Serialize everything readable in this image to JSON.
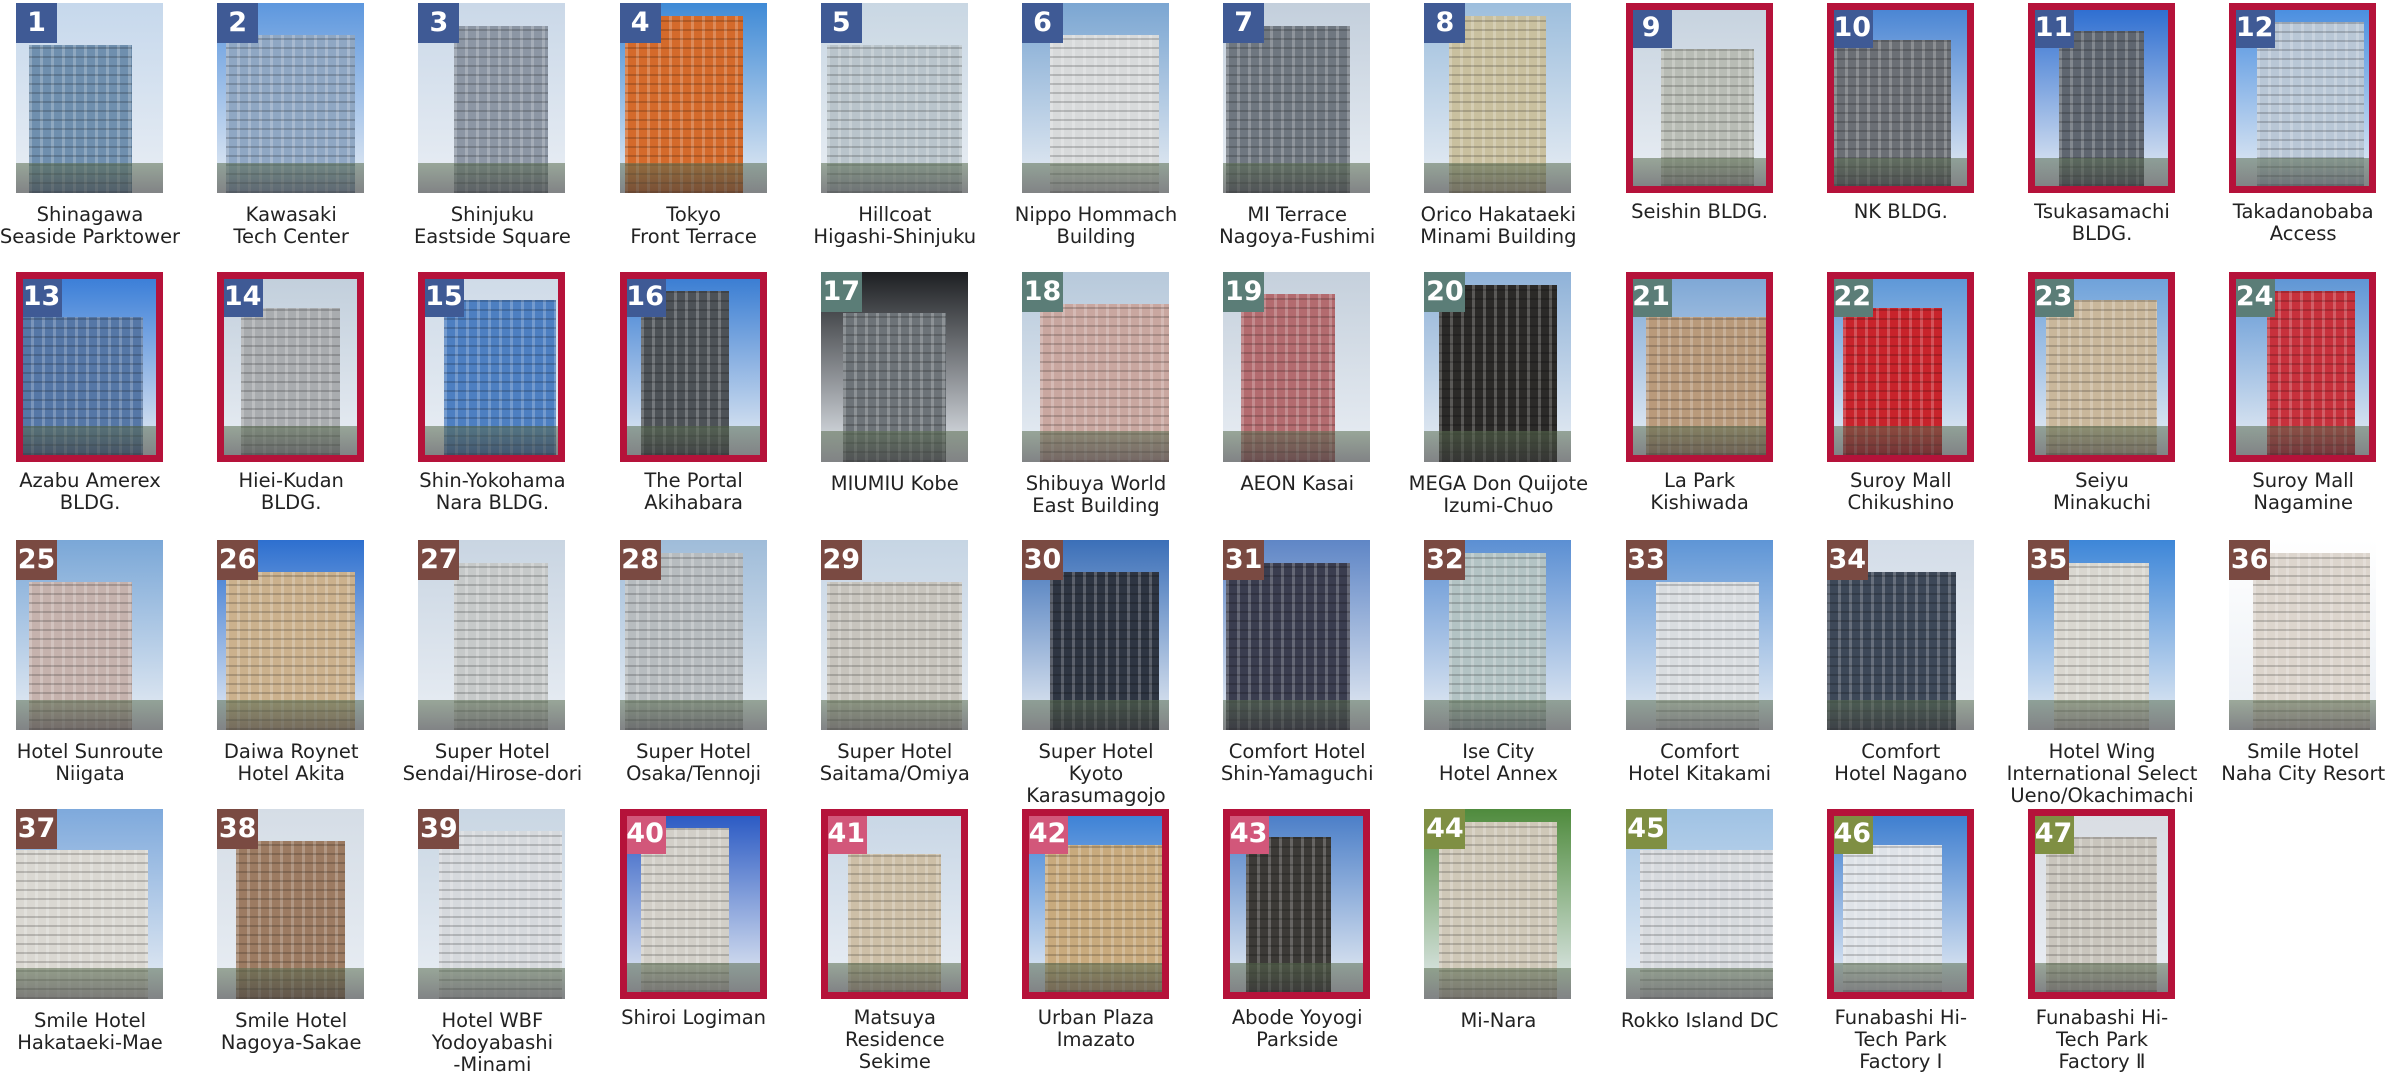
{
  "colors": {
    "highlight_border": "#b5123a",
    "category_badge": [
      "#3f5a95",
      "#5b7d77",
      "#7a4a42",
      "#d2577a",
      "#7f8f43"
    ]
  },
  "properties": [
    {
      "num": "1",
      "name": "Shinagawa\nSeaside Parktower",
      "badge_color": "#3f5a95",
      "highlighted": false,
      "sky": "#c6d8ec",
      "bldg": "#6f8fae"
    },
    {
      "num": "2",
      "name": "Kawasaki\nTech Center",
      "badge_color": "#3f5a95",
      "highlighted": false,
      "sky": "#5d97de",
      "bldg": "#8fa7c3"
    },
    {
      "num": "3",
      "name": "Shinjuku\nEastside Square",
      "badge_color": "#3f5a95",
      "highlighted": false,
      "sky": "#cad8e8",
      "bldg": "#8c96a4"
    },
    {
      "num": "4",
      "name": "Tokyo\nFront Terrace",
      "badge_color": "#3f5a95",
      "highlighted": false,
      "sky": "#3f8ad6",
      "bldg": "#d46a2b"
    },
    {
      "num": "5",
      "name": "Hillcoat\nHigashi-Shinjuku",
      "badge_color": "#3f5a95",
      "highlighted": false,
      "sky": "#c9d7e3",
      "bldg": "#b9c4cb"
    },
    {
      "num": "6",
      "name": "Nippo Hommach\nBuilding",
      "badge_color": "#3f5a95",
      "highlighted": false,
      "sky": "#7ba6d2",
      "bldg": "#d8dadb"
    },
    {
      "num": "7",
      "name": "MI Terrace\nNagoya-Fushimi",
      "badge_color": "#3f5a95",
      "highlighted": false,
      "sky": "#c3cfdc",
      "bldg": "#6f7780"
    },
    {
      "num": "8",
      "name": "Orico Hakataeki\nMinami Building",
      "badge_color": "#3f5a95",
      "highlighted": false,
      "sky": "#9dbedd",
      "bldg": "#c9c09f"
    },
    {
      "num": "9",
      "name": "Seishin BLDG.",
      "badge_color": "#3f5a95",
      "highlighted": true,
      "sky": "#c7d3df",
      "bldg": "#b8bcb5"
    },
    {
      "num": "10",
      "name": "NK BLDG.",
      "badge_color": "#3f5a95",
      "highlighted": true,
      "sky": "#4b86d4",
      "bldg": "#6b6f75"
    },
    {
      "num": "11",
      "name": "Tsukasamachi\nBLDG.",
      "badge_color": "#3f5a95",
      "highlighted": true,
      "sky": "#2f6fd1",
      "bldg": "#5f6670"
    },
    {
      "num": "12",
      "name": "Takadanobaba\nAccess",
      "badge_color": "#3f5a95",
      "highlighted": true,
      "sky": "#4b8fe0",
      "bldg": "#b9c7d6"
    },
    {
      "num": "13",
      "name": "Azabu Amerex\nBLDG.",
      "badge_color": "#3f5a95",
      "highlighted": true,
      "sky": "#3c7fd8",
      "bldg": "#5577a6"
    },
    {
      "num": "14",
      "name": "Hiei-Kudan\nBLDG.",
      "badge_color": "#3f5a95",
      "highlighted": true,
      "sky": "#c2cfdc",
      "bldg": "#a9acaf"
    },
    {
      "num": "15",
      "name": "Shin-Yokohama\nNara BLDG.",
      "badge_color": "#3f5a95",
      "highlighted": true,
      "sky": "#cfdbe8",
      "bldg": "#4d7fc1"
    },
    {
      "num": "16",
      "name": "The Portal\nAkihabara",
      "badge_color": "#3f5a95",
      "highlighted": true,
      "sky": "#3b7ed3",
      "bldg": "#4d5257"
    },
    {
      "num": "17",
      "name": "MIUMIU Kobe",
      "badge_color": "#5b7d77",
      "highlighted": false,
      "sky": "#1d1f22",
      "bldg": "#6d7378"
    },
    {
      "num": "18",
      "name": "Shibuya World\nEast Building",
      "badge_color": "#5b7d77",
      "highlighted": false,
      "sky": "#b7c9db",
      "bldg": "#c9a7a0"
    },
    {
      "num": "19",
      "name": "AEON Kasai",
      "badge_color": "#5b7d77",
      "highlighted": false,
      "sky": "#c5d0dc",
      "bldg": "#b36b6f"
    },
    {
      "num": "20",
      "name": "MEGA Don Quijote\nIzumi-Chuo",
      "badge_color": "#5b7d77",
      "highlighted": false,
      "sky": "#8fb2d8",
      "bldg": "#2b2a28"
    },
    {
      "num": "21",
      "name": "La Park\nKishiwada",
      "badge_color": "#5b7d77",
      "highlighted": true,
      "sky": "#7fa8d6",
      "bldg": "#b99a7b"
    },
    {
      "num": "22",
      "name": "Suroy Mall\nChikushino",
      "badge_color": "#5b7d77",
      "highlighted": true,
      "sky": "#5e98d8",
      "bldg": "#c8232b"
    },
    {
      "num": "23",
      "name": "Seiyu\nMinakuchi",
      "badge_color": "#5b7d77",
      "highlighted": true,
      "sky": "#6fa2da",
      "bldg": "#c9b79b"
    },
    {
      "num": "24",
      "name": "Suroy Mall\nNagamine",
      "badge_color": "#5b7d77",
      "highlighted": true,
      "sky": "#5f96d5",
      "bldg": "#c7313c"
    },
    {
      "num": "25",
      "name": "Hotel Sunroute\nNiigata",
      "badge_color": "#7a4a42",
      "highlighted": false,
      "sky": "#7aa7d7",
      "bldg": "#c5b2ad"
    },
    {
      "num": "26",
      "name": "Daiwa Roynet\nHotel Akita",
      "badge_color": "#7a4a42",
      "highlighted": false,
      "sky": "#2d6fcf",
      "bldg": "#cbb18d"
    },
    {
      "num": "27",
      "name": "Super Hotel\nSendai/Hirose-dori",
      "badge_color": "#7a4a42",
      "highlighted": false,
      "sky": "#c9d5e2",
      "bldg": "#c6c9c9"
    },
    {
      "num": "28",
      "name": "Super Hotel\nOsaka/Tennoji",
      "badge_color": "#7a4a42",
      "highlighted": false,
      "sky": "#9fbcd9",
      "bldg": "#b7bcbf"
    },
    {
      "num": "29",
      "name": "Super Hotel\nSaitama/Omiya",
      "badge_color": "#7a4a42",
      "highlighted": false,
      "sky": "#c6d5e4",
      "bldg": "#c7c4bd"
    },
    {
      "num": "30",
      "name": "Super Hotel\nKyoto\nKarasumagojo",
      "badge_color": "#7a4a42",
      "highlighted": false,
      "sky": "#3b6fb8",
      "bldg": "#2e3542"
    },
    {
      "num": "31",
      "name": "Comfort Hotel\nShin-Yamaguchi",
      "badge_color": "#7a4a42",
      "highlighted": false,
      "sky": "#5f86c6",
      "bldg": "#3a3d4f"
    },
    {
      "num": "32",
      "name": "Ise City\nHotel Annex",
      "badge_color": "#7a4a42",
      "highlighted": false,
      "sky": "#5b8fd3",
      "bldg": "#b3c3c4"
    },
    {
      "num": "33",
      "name": "Comfort\nHotel Kitakami",
      "badge_color": "#7a4a42",
      "highlighted": false,
      "sky": "#5e95d6",
      "bldg": "#d9dde0"
    },
    {
      "num": "34",
      "name": "Comfort\nHotel Nagano",
      "badge_color": "#7a4a42",
      "highlighted": false,
      "sky": "#d4dde8",
      "bldg": "#3d4858"
    },
    {
      "num": "35",
      "name": "Hotel Wing\nInternational Select\nUeno/Okachimachi",
      "badge_color": "#7a4a42",
      "highlighted": false,
      "sky": "#3d86d8",
      "bldg": "#d9d7d0"
    },
    {
      "num": "36",
      "name": "Smile Hotel\nNaha City Resort",
      "badge_color": "#7a4a42",
      "highlighted": false,
      "sky": "#ffffff",
      "bldg": "#dcd5cd"
    },
    {
      "num": "37",
      "name": "Smile Hotel\nHakataeki-Mae",
      "badge_color": "#7a4a42",
      "highlighted": false,
      "sky": "#7ea9dc",
      "bldg": "#dad8d2"
    },
    {
      "num": "38",
      "name": "Smile Hotel\nNagoya-Sakae",
      "badge_color": "#7a4a42",
      "highlighted": false,
      "sky": "#d5dde6",
      "bldg": "#9c7b62"
    },
    {
      "num": "39",
      "name": "Hotel WBF\nYodoyabashi\n-Minami",
      "badge_color": "#7a4a42",
      "highlighted": false,
      "sky": "#c9d6e3",
      "bldg": "#d6d9dd"
    },
    {
      "num": "40",
      "name": "Shiroi Logiman",
      "badge_color": "#d2577a",
      "highlighted": true,
      "sky": "#2c5bc4",
      "bldg": "#d2cfc8"
    },
    {
      "num": "41",
      "name": "Matsuya\nResidence\nSekime",
      "badge_color": "#d2577a",
      "highlighted": true,
      "sky": "#c9d7e6",
      "bldg": "#cdbfa7"
    },
    {
      "num": "42",
      "name": "Urban Plaza\nImazato",
      "badge_color": "#d2577a",
      "highlighted": true,
      "sky": "#3e82d6",
      "bldg": "#c8aa7d"
    },
    {
      "num": "43",
      "name": "Abode Yoyogi\nParkside",
      "badge_color": "#d2577a",
      "highlighted": true,
      "sky": "#4c7fc8",
      "bldg": "#3c3a37"
    },
    {
      "num": "44",
      "name": "Mi-Nara",
      "badge_color": "#7f8f43",
      "highlighted": false,
      "sky": "#4f8b3d",
      "bldg": "#cfc8b8"
    },
    {
      "num": "45",
      "name": "Rokko Island DC",
      "badge_color": "#7f8f43",
      "highlighted": false,
      "sky": "#9fc2e4",
      "bldg": "#d7dade"
    },
    {
      "num": "46",
      "name": "Funabashi Hi-\nTech Park\nFactory Ⅰ",
      "badge_color": "#7f8f43",
      "highlighted": true,
      "sky": "#3f7fd0",
      "bldg": "#dfe3e8"
    },
    {
      "num": "47",
      "name": "Funabashi Hi-\nTech Park\nFactory Ⅱ",
      "badge_color": "#7f8f43",
      "highlighted": true,
      "sky": "#d9dde3",
      "bldg": "#c9c5bd"
    }
  ]
}
